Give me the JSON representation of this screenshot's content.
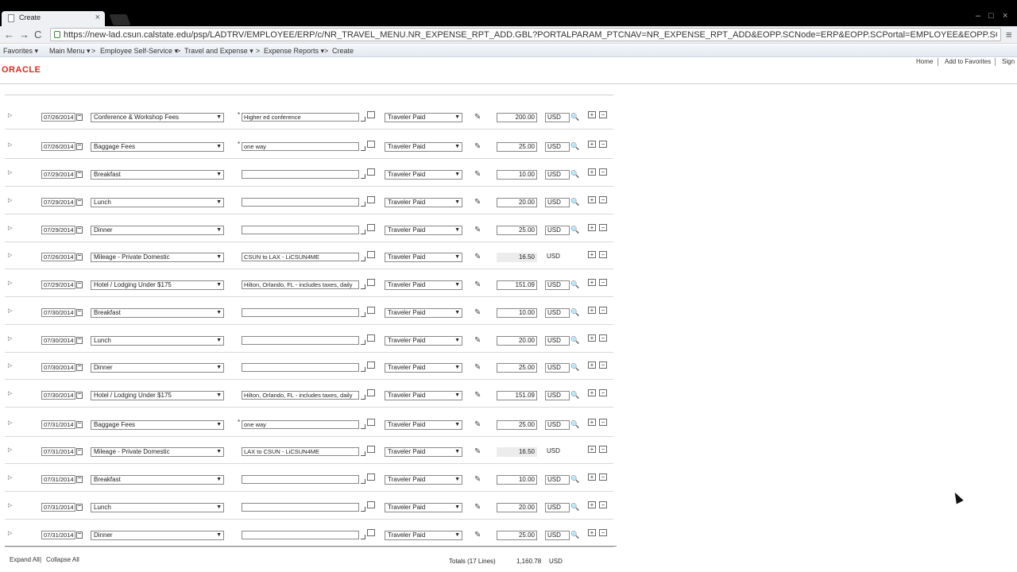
{
  "browser": {
    "tab_title": "Create",
    "url": "https://new-lad.csun.calstate.edu/psp/LADTRV/EMPLOYEE/ERP/c/NR_TRAVEL_MENU.NR_EXPENSE_RPT_ADD.GBL?PORTALPARAM_PTCNAV=NR_EXPENSE_RPT_ADD&EOPP.SCNode=ERP&EOPP.SCPortal=EMPLOYEE&EOPP.SCName=ADMN_TRAVI",
    "tab_close": "×",
    "back": "←",
    "forward": "→",
    "reload": "C",
    "menu": "≡"
  },
  "breadcrumb": {
    "favorites": "Favorites ▾",
    "main_menu": "Main Menu ▾",
    "sep": ">",
    "employee_self_service": "Employee Self-Service ▾",
    "travel_and_expense": "Travel and Expense ▾",
    "expense_reports": "Expense Reports ▾",
    "create": "Create"
  },
  "header": {
    "logo": "ORACLE",
    "home": "Home",
    "add_to_favorites": "Add to Favorites",
    "sign_out": "Sign"
  },
  "rows": [
    {
      "date": "07/26/2014",
      "type": "Conference & Workshop Fees",
      "required": "*",
      "description": "Higher ed conference",
      "payment": "Traveler Paid",
      "amount": "200.00",
      "currency": "USD",
      "readonly": false
    },
    {
      "date": "07/26/2014",
      "type": "Baggage Fees",
      "required": "*",
      "description": "one way",
      "payment": "Traveler Paid",
      "amount": "25.00",
      "currency": "USD",
      "readonly": false
    },
    {
      "date": "07/29/2014",
      "type": "Breakfast",
      "required": "",
      "description": "",
      "payment": "Traveler Paid",
      "amount": "10.00",
      "currency": "USD",
      "readonly": false
    },
    {
      "date": "07/29/2014",
      "type": "Lunch",
      "required": "",
      "description": "",
      "payment": "Traveler Paid",
      "amount": "20.00",
      "currency": "USD",
      "readonly": false
    },
    {
      "date": "07/29/2014",
      "type": "Dinner",
      "required": "",
      "description": "",
      "payment": "Traveler Paid",
      "amount": "25.00",
      "currency": "USD",
      "readonly": false
    },
    {
      "date": "07/26/2014",
      "type": "Mileage - Private Domestic",
      "required": "",
      "description": "CSUN to LAX - LiCSUN4ME",
      "payment": "Traveler Paid",
      "amount": "16.50",
      "currency": "USD",
      "readonly": true
    },
    {
      "date": "07/29/2014",
      "type": "Hotel / Lodging Under $175",
      "required": "",
      "description": "Hilton, Orlando, FL - includes taxes, daily",
      "payment": "Traveler Paid",
      "amount": "151.09",
      "currency": "USD",
      "readonly": false
    },
    {
      "date": "07/30/2014",
      "type": "Breakfast",
      "required": "",
      "description": "",
      "payment": "Traveler Paid",
      "amount": "10.00",
      "currency": "USD",
      "readonly": false
    },
    {
      "date": "07/30/2014",
      "type": "Lunch",
      "required": "",
      "description": "",
      "payment": "Traveler Paid",
      "amount": "20.00",
      "currency": "USD",
      "readonly": false
    },
    {
      "date": "07/30/2014",
      "type": "Dinner",
      "required": "",
      "description": "",
      "payment": "Traveler Paid",
      "amount": "25.00",
      "currency": "USD",
      "readonly": false
    },
    {
      "date": "07/30/2014",
      "type": "Hotel / Lodging Under $175",
      "required": "",
      "description": "Hilton, Orlando, FL - includes taxes, daily",
      "payment": "Traveler Paid",
      "amount": "151.09",
      "currency": "USD",
      "readonly": false
    },
    {
      "date": "07/31/2014",
      "type": "Baggage Fees",
      "required": "*",
      "description": "one way",
      "payment": "Traveler Paid",
      "amount": "25.00",
      "currency": "USD",
      "readonly": false
    },
    {
      "date": "07/31/2014",
      "type": "Mileage - Private Domestic",
      "required": "",
      "description": "LAX to CSUN - LiCSUN4ME",
      "payment": "Traveler Paid",
      "amount": "16.50",
      "currency": "USD",
      "readonly": true
    },
    {
      "date": "07/31/2014",
      "type": "Breakfast",
      "required": "",
      "description": "",
      "payment": "Traveler Paid",
      "amount": "10.00",
      "currency": "USD",
      "readonly": false
    },
    {
      "date": "07/31/2014",
      "type": "Lunch",
      "required": "",
      "description": "",
      "payment": "Traveler Paid",
      "amount": "20.00",
      "currency": "USD",
      "readonly": false
    },
    {
      "date": "07/31/2014",
      "type": "Dinner",
      "required": "",
      "description": "",
      "payment": "Traveler Paid",
      "amount": "25.00",
      "currency": "USD",
      "readonly": false
    }
  ],
  "row_glyphs": {
    "expander": "▷",
    "dropdown": "▼",
    "pencil": "✎",
    "lookup": "🔍",
    "add": "+",
    "delete": "−"
  },
  "footer": {
    "expand_all": "Expand All",
    "separator": "|",
    "collapse_all": "Collapse All",
    "totals_label": "Totals (17 Lines)",
    "totals_value": "1,160.78",
    "totals_currency": "USD"
  },
  "colors": {
    "oracle_red": "#d52b1e",
    "readonly_gray": "#ececec"
  }
}
